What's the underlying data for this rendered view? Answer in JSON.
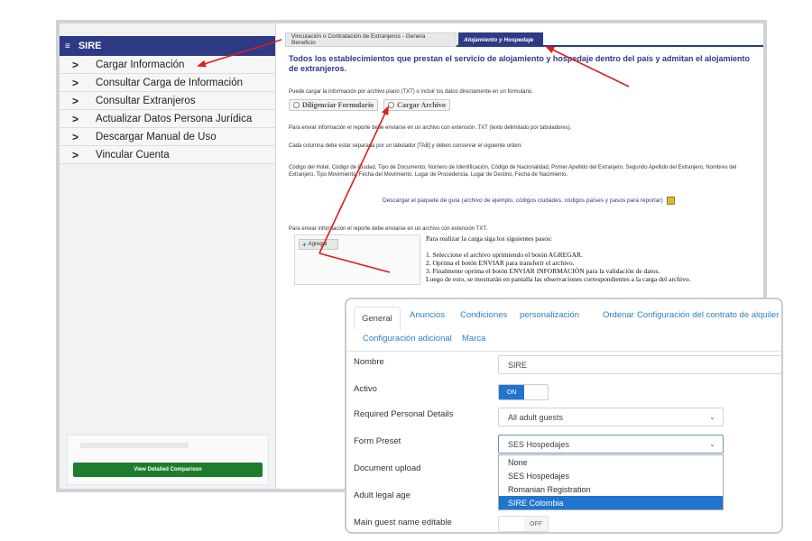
{
  "sidebar": {
    "header": "SIRE",
    "items": [
      {
        "label": "Cargar Información"
      },
      {
        "label": "Consultar Carga de Información"
      },
      {
        "label": "Consultar Extranjeros"
      },
      {
        "label": "Actualizar Datos Persona Jurídica"
      },
      {
        "label": "Descargar Manual de Uso"
      },
      {
        "label": "Vincular Cuenta"
      }
    ],
    "compare_button": "View Detailed Comparison"
  },
  "content": {
    "tabs": [
      {
        "label": "Vinculación o Contratación de Extranjeros - Genera Beneficio"
      },
      {
        "label": "Alojamiento y Hospedaje"
      }
    ],
    "title": "Todos los establecimientos que prestan el servicio de alojamiento y hospedaje dentro del país y admitan el alojamiento de extranjeros.",
    "intro": "Puede cargar la información por archivo plano (TXT) o incluir los datos directamente en un formulario.",
    "buttons": {
      "form": "Diligenciar Formulario",
      "upload": "Cargar Archivo"
    },
    "text1": "Para enviar información el reporte debe enviarse en un archivo con extensión .TXT (texto delimitado por tabuladores).",
    "text2": "Cada columna debe estar separada por un tabulador [TAB] y deben conservar el siguiente orden:",
    "columns": "Código del Hotel, Código de Ciudad, Tipo de Documento, Número de Identificación, Código de Nacionalidad, Primer Apellido del Extranjero, Segundo Apellido del Extranjero, Nombres del Extranjero, Tipo Movimiento, Fecha del Movimiento, Lugar de Procedencia, Lugar de Destino, Fecha de Nacimiento.",
    "package_link": "Descargar el paquete de guía (archivo de ejemplo, códigos ciudades, códigos países y pasos para reportar)",
    "text3": "Para enviar información el reporte debe enviarse en un archivo con extensión TXT.",
    "add_button": "Agregar",
    "steps": [
      "Para realizar la carga siga los siguientes pasos:",
      "1. Seleccione el archivo oprimiendo el botón AGREGAR.",
      "2. Oprima el botón ENVIAR para transferir el archivo.",
      "3. Finalmente oprima el botón ENVIAR INFORMACIÓN para la validación de datos.",
      "Luego de esto, se mostrarán en pantalla las observaciones correspondientes a la carga del archivo."
    ]
  },
  "panel": {
    "tabs": [
      {
        "label": "General"
      },
      {
        "label": "Anuncios"
      },
      {
        "label": "Condiciones"
      },
      {
        "label": "personalización"
      },
      {
        "label": "Ordenar"
      },
      {
        "label": "Configuración del contrato de alquiler"
      },
      {
        "label": "Configuración adicional"
      },
      {
        "label": "Marca"
      }
    ],
    "fields": {
      "name_label": "Nombre",
      "name_value": "SIRE",
      "active_label": "Activo",
      "active_state": "ON",
      "rpd_label": "Required Personal Details",
      "rpd_value": "All adult guests",
      "preset_label": "Form Preset",
      "preset_value": "SES Hospedajes",
      "doc_label": "Document upload",
      "age_label": "Adult legal age",
      "mgne_label": "Main guest name editable",
      "mgne_state": "OFF"
    },
    "preset_options": [
      "None",
      "SES Hospedajes",
      "Romanian Registration",
      "SIRE Colombia"
    ],
    "selected_option_index": 3
  },
  "colors": {
    "brand_navy": "#2f3a86",
    "annotation_red": "#e01b1b",
    "toggle_blue": "#1f75cf",
    "link_blue": "#2d7fbf",
    "compare_green": "#1e7d2a"
  }
}
